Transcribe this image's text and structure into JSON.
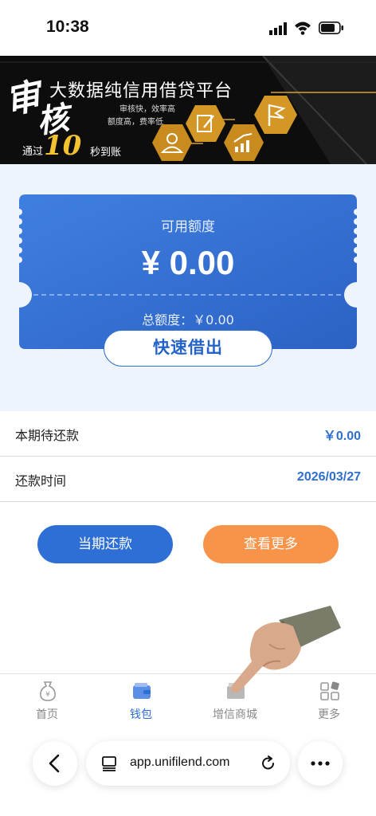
{
  "status_bar": {
    "time": "10:38"
  },
  "banner": {
    "char_1": "审",
    "char_2": "核",
    "title": "大数据纯信用借贷平台",
    "sub_1": "审核快，效率高",
    "sub_2": "额度高，费率低",
    "arrive_prefix": "通过",
    "ten": "10",
    "arrive_suffix": "秒到账"
  },
  "credit_card": {
    "available_label": "可用额度",
    "available_amount": "¥ 0.00",
    "total_label": "总额度：￥0.00",
    "borrow_button": "快速借出"
  },
  "rows": [
    {
      "label": "本期待还款",
      "value": "￥0.00"
    },
    {
      "label": "还款时间",
      "value": "2026/03/27"
    }
  ],
  "buttons": {
    "repay": "当期还款",
    "view_more": "查看更多"
  },
  "tabs": [
    {
      "label": "首页",
      "icon": "money-bag-icon"
    },
    {
      "label": "钱包",
      "icon": "wallet-icon",
      "active": true
    },
    {
      "label": "增信商城",
      "icon": "shop-icon"
    },
    {
      "label": "更多",
      "icon": "grid-icon"
    }
  ],
  "browser": {
    "url": "app.unifilend.com"
  },
  "colors": {
    "primary": "#2e6fd6",
    "accent": "#f7944a",
    "section_bg": "#eef4fc"
  }
}
